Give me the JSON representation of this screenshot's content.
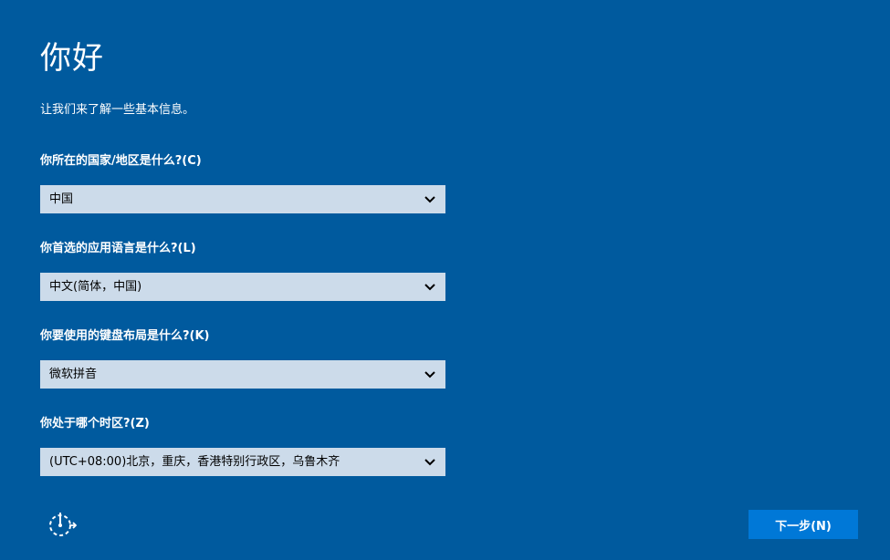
{
  "page": {
    "title": "你好",
    "subtitle": "让我们来了解一些基本信息。"
  },
  "fields": [
    {
      "label": "你所在的国家/地区是什么?(C)",
      "value": "中国"
    },
    {
      "label": "你首选的应用语言是什么?(L)",
      "value": "中文(简体，中国)"
    },
    {
      "label": "你要使用的键盘布局是什么?(K)",
      "value": "微软拼音"
    },
    {
      "label": "你处于哪个时区?(Z)",
      "value": "(UTC+08:00)北京，重庆，香港特别行政区，乌鲁木齐"
    }
  ],
  "footer": {
    "accessibility_icon": "ease-of-access-icon",
    "next_label": "下一步(N)"
  },
  "colors": {
    "background": "#005a9e",
    "dropdown": "#ccdbea",
    "button": "#0078d7"
  }
}
